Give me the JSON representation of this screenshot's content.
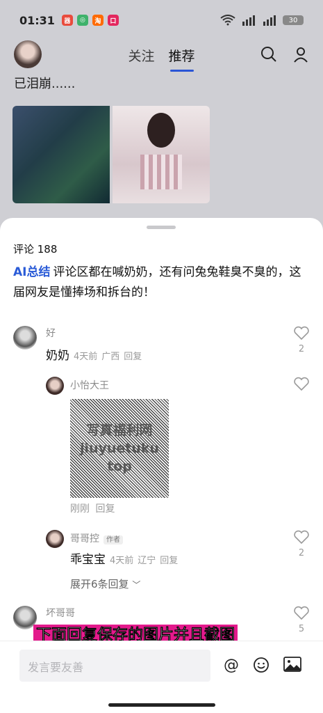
{
  "status": {
    "time": "01:31",
    "apps": [
      {
        "name": "app-icon-red",
        "color": "#e94b3c",
        "glyph": "器"
      },
      {
        "name": "app-icon-green",
        "color": "#3fb26b",
        "glyph": "◎"
      },
      {
        "name": "app-icon-taobao",
        "color": "#ff6a00",
        "glyph": "淘"
      },
      {
        "name": "app-icon-pink",
        "color": "#e3275e",
        "glyph": "口"
      }
    ],
    "battery": "30"
  },
  "top_nav": {
    "tabs": [
      "关注",
      "推荐"
    ],
    "active": "推荐"
  },
  "post": {
    "text": "已泪崩......"
  },
  "sheet": {
    "count_label": "评论 188",
    "ai_tag": "AI总结",
    "ai_text": "评论区都在喊奶奶，还有问兔兔鞋臭不臭的，这届网友是懂捧场和拆台的！"
  },
  "comments": [
    {
      "user": "好",
      "text": "奶奶",
      "time": "4天前",
      "location": "广西",
      "reply": "回复",
      "likes": "2"
    },
    {
      "user": "小怡大王",
      "time": "刚刚",
      "reply": "回复",
      "watermark": [
        "写真福利网",
        "jiuyuetuku",
        "top"
      ]
    },
    {
      "user": "哥哥控",
      "badge": "作者",
      "text": "乖宝宝",
      "time": "4天前",
      "location": "辽宁",
      "reply": "回复",
      "likes": "2"
    },
    {
      "user": "坏哥哥",
      "likes": "5"
    }
  ],
  "expand_label": "展开6条回复",
  "caption": "下面回复保存的图片并且截图",
  "input": {
    "placeholder": "发言要友善"
  }
}
